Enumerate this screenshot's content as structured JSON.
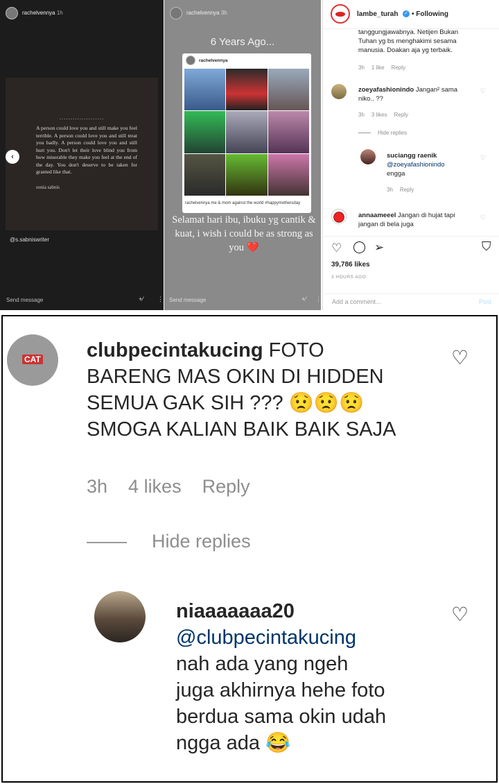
{
  "story1": {
    "username": "rachelvennya",
    "time": "1h",
    "quote_dots": "....................",
    "quote": "A person could love you and still make you feel terrible. A person could love you and still treat you badly. A person could love you and still hurt you. Don't let their love blind you from how miserable they make you feel at the end of the day. You don't deserve to be taken for granted like that.",
    "author": "sonia sabnis",
    "mention": "@s.sabniswriter",
    "send_message": "Send message"
  },
  "story2": {
    "username": "rachelvennya",
    "time": "3h",
    "title": "6 Years Ago...",
    "card_user": "rachelvennya",
    "card_caption": "rachelvennya me & mom against the world #happymothersday",
    "caption": "Selamat hari ibu, ibuku yg cantik & kuat, i wish i could be as strong as you",
    "heart": "❤️",
    "send_message": "Send message"
  },
  "post": {
    "username": "lambe_turah",
    "verified": "✓",
    "following": "• Following",
    "partial_comment": "tanggungjawabnya. Netijen Bukan Tuhan yg bs menghakimi sesama manusia. Doakan aja yg terbaik.",
    "partial_meta": {
      "time": "3h",
      "likes": "1 like",
      "reply": "Reply"
    },
    "comments": [
      {
        "user": "zoeyafashionindo",
        "text": "Jangan² sama niko.. ??",
        "time": "3h",
        "likes": "3 likes",
        "reply": "Reply"
      },
      {
        "user": "suciangg raenik",
        "mention": "@zoeyafashionindo",
        "text": "engga",
        "time": "3h",
        "reply": "Reply"
      },
      {
        "user": "annaameeel",
        "text": "Jangan di hujat tapi jangan di bela juga"
      }
    ],
    "hide_replies": "Hide replies",
    "likes": "39,786 likes",
    "ago": "3 HOURS AGO",
    "add_comment": "Add a comment...",
    "post_label": "Post"
  },
  "zoom": {
    "comment": {
      "user": "clubpecintakucing",
      "avatar_label": "CAT",
      "lines": [
        "FOTO",
        "BARENG MAS OKIN DI HIDDEN",
        "SEMUA GAK SIH ??? 😟😟😟",
        "SMOGA KALIAN BAIK BAIK SAJA"
      ],
      "time": "3h",
      "likes": "4 likes",
      "reply": "Reply"
    },
    "hide_replies": "Hide replies",
    "reply": {
      "user": "niaaaaaaa20",
      "mention": "@clubpecintakucing",
      "lines": [
        "nah ada yang ngeh",
        "juga akhirnya hehe foto",
        "berdua sama okin udah",
        "ngga ada 😂"
      ]
    }
  }
}
